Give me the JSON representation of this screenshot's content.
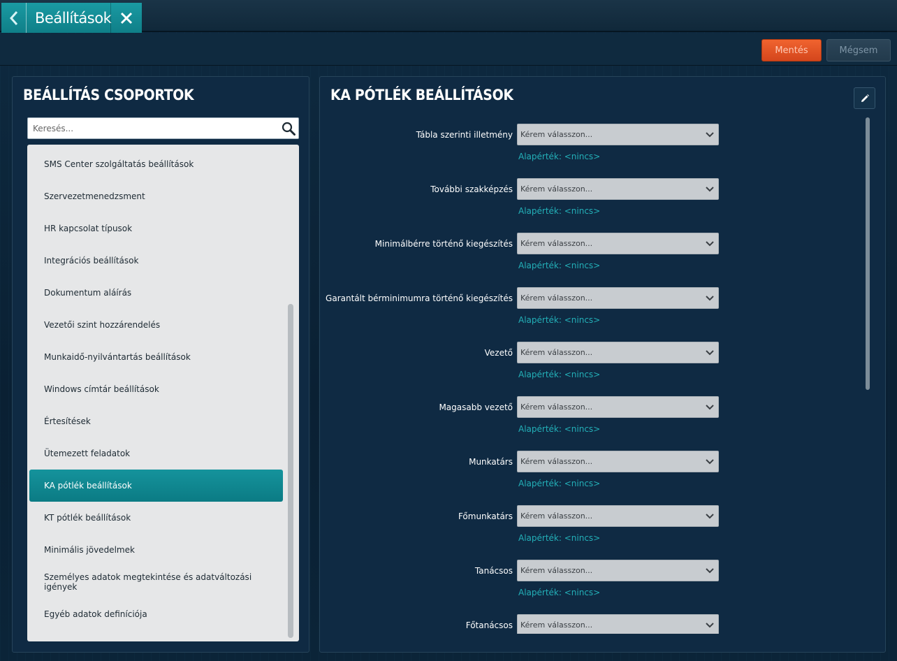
{
  "tab": {
    "title": "Beállítások"
  },
  "actions": {
    "save_label": "Mentés",
    "cancel_label": "Mégsem"
  },
  "left": {
    "title": "BEÁLLÍTÁS CSOPORTOK",
    "search_placeholder": "Keresés...",
    "items": [
      "SMS Center szolgáltatás beállítások",
      "Szervezetmenedzsment",
      "HR kapcsolat típusok",
      "Integrációs beállítások",
      "Dokumentum aláírás",
      "Vezetői szint hozzárendelés",
      "Munkaidő-nyilvántartás beállítások",
      "Windows címtár beállítások",
      "Értesítések",
      "Ütemezett feladatok",
      "KA pótlék beállítások",
      "KT pótlék beállítások",
      "Minimális jövedelmek",
      "Személyes adatok megtekintése és adatváltozási igények",
      "Egyéb adatok definíciója"
    ],
    "selected_index": 10
  },
  "right": {
    "title": "KA PÓTLÉK BEÁLLÍTÁSOK",
    "select_placeholder": "Kérem válasszon...",
    "default_label": "Alapérték: <nincs>",
    "fields": [
      "Tábla szerinti illetmény",
      "További szakképzés",
      "Minimálbérre történő kiegészítés",
      "Garantált bérminimumra történő kiegészítés",
      "Vezető",
      "Magasabb vezető",
      "Munkatárs",
      "Főmunkatárs",
      "Tanácsos",
      "Főtanácsos"
    ]
  },
  "colors": {
    "accent": "#0f7f88",
    "save": "#e2552a",
    "default_text": "#23b0b8"
  }
}
